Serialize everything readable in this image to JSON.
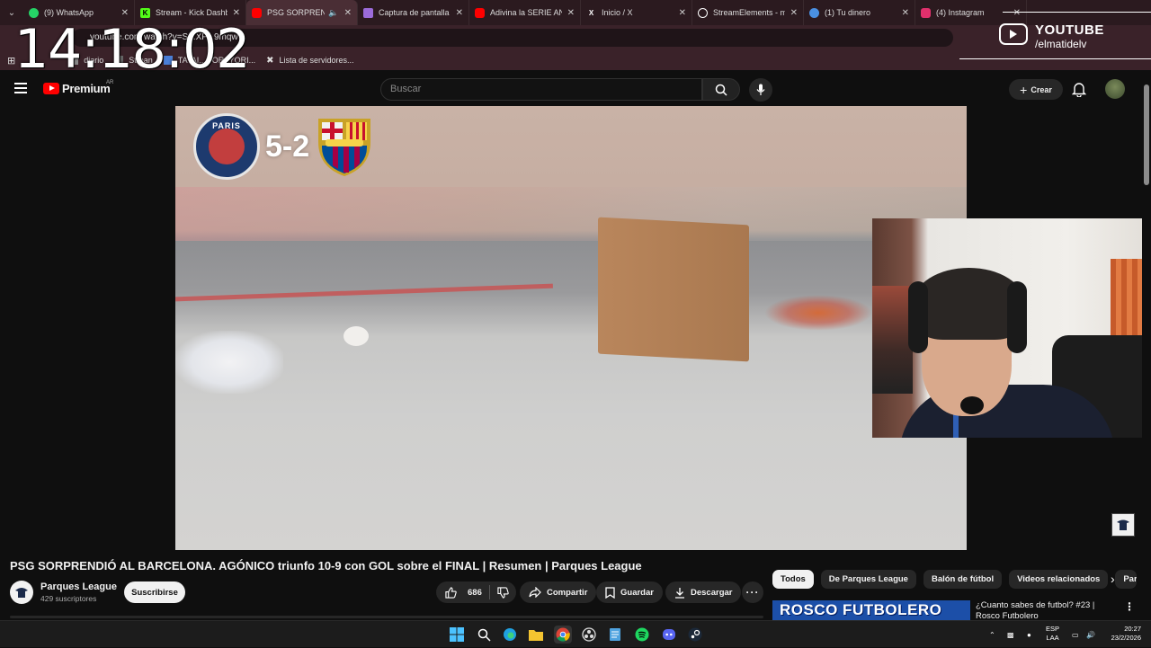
{
  "browser": {
    "tabs": [
      {
        "label": "(9) WhatsApp",
        "icon": "whatsapp-icon",
        "color": "#25d366"
      },
      {
        "label": "Stream - Kick Dashbo",
        "icon": "kick-icon",
        "color": "#53fc18"
      },
      {
        "label": "PSG SORPRENDI",
        "icon": "youtube-icon",
        "color": "#ff0000"
      },
      {
        "label": "Captura de pantalla p",
        "icon": "pen-icon",
        "color": "#9b6bd9"
      },
      {
        "label": "Adivina la SERIE ANII",
        "icon": "youtube-icon",
        "color": "#ff0000"
      },
      {
        "label": "Inicio / X",
        "icon": "x-icon",
        "color": "#ffffff"
      },
      {
        "label": "StreamElements - m",
        "icon": "streamelements-icon",
        "color": "#ffffff"
      },
      {
        "label": "(1) Tu dinero",
        "icon": "wallet-icon",
        "color": "#4a90e2"
      },
      {
        "label": "(4) Instagram",
        "icon": "instagram-icon",
        "color": "#e1306c"
      }
    ],
    "address": "youtube.com/watch?v=S...XP...9mqw",
    "bookmarks": [
      "diario",
      "Strean",
      "TATAI...GORAYORI...",
      "Lista de servidores..."
    ]
  },
  "overlay": {
    "clock": "14:18:02",
    "platform": "YOUTUBE",
    "handle": "/elmatidelv"
  },
  "youtube": {
    "logo_text": "Premium",
    "region": "AR",
    "search_placeholder": "Buscar",
    "create_label": "Crear"
  },
  "video": {
    "score_home_label": "PARIS",
    "score": "5-2",
    "title": "PSG SORPRENDIÓ AL BARCELONA. AGÓNICO triunfo 10-9 con GOL sobre el FINAL | Resumen | Parques League",
    "channel": "Parques League",
    "subscribers": "429 suscriptores",
    "subscribe_label": "Suscribirse",
    "likes": "686",
    "share_label": "Compartir",
    "save_label": "Guardar",
    "download_label": "Descargar"
  },
  "sidebar": {
    "chips": [
      "Todos",
      "De Parques League",
      "Balón de fútbol",
      "Videos relacionados",
      "Par"
    ],
    "related": {
      "thumb_text": "ROSCO FUTBOLERO",
      "title": "¿Cuanto sabes de futbol? #23 | Rosco Futbolero"
    }
  },
  "taskbar": {
    "lang": "ESP",
    "lang2": "LAA",
    "time": "20:27",
    "date": "23/2/2026"
  }
}
